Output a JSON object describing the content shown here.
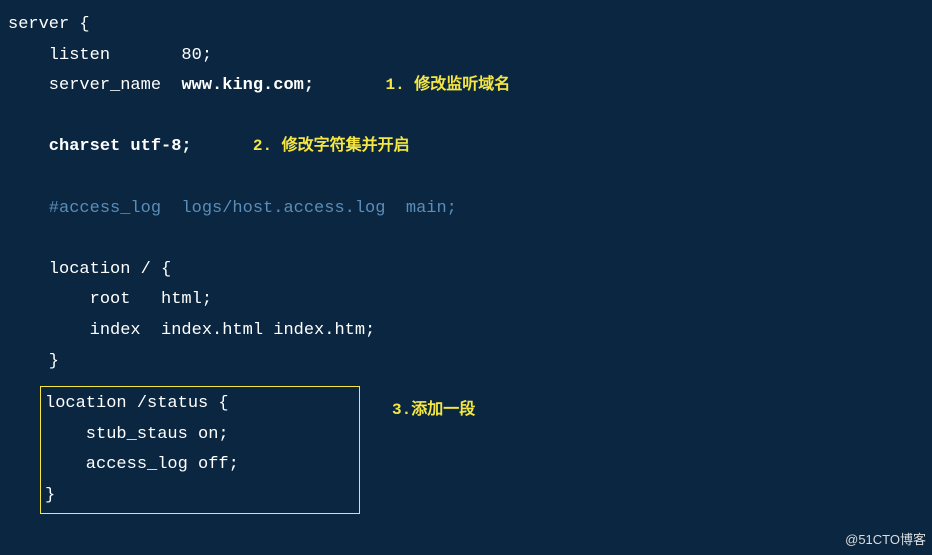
{
  "code": {
    "line1": "server {",
    "line2": "    listen       80;",
    "line3_part1": "    server_name  ",
    "line3_part2": "www.king.com;",
    "line4": "",
    "line5": "    charset utf-8;",
    "line6": "",
    "line7": "    #access_log  logs/host.access.log  main;",
    "line8": "",
    "line9": "    location / {",
    "line10": "        root   html;",
    "line11": "        index  index.html index.htm;",
    "line12": "    }",
    "boxed_line1": "location /status {",
    "boxed_line2": "    stub_staus on;",
    "boxed_line3": "    access_log off;",
    "boxed_line4": "}"
  },
  "annotations": {
    "a1": "1. 修改监听域名",
    "a2": "2. 修改字符集并开启",
    "a3": "3.添加一段"
  },
  "watermark": "@51CTO博客"
}
